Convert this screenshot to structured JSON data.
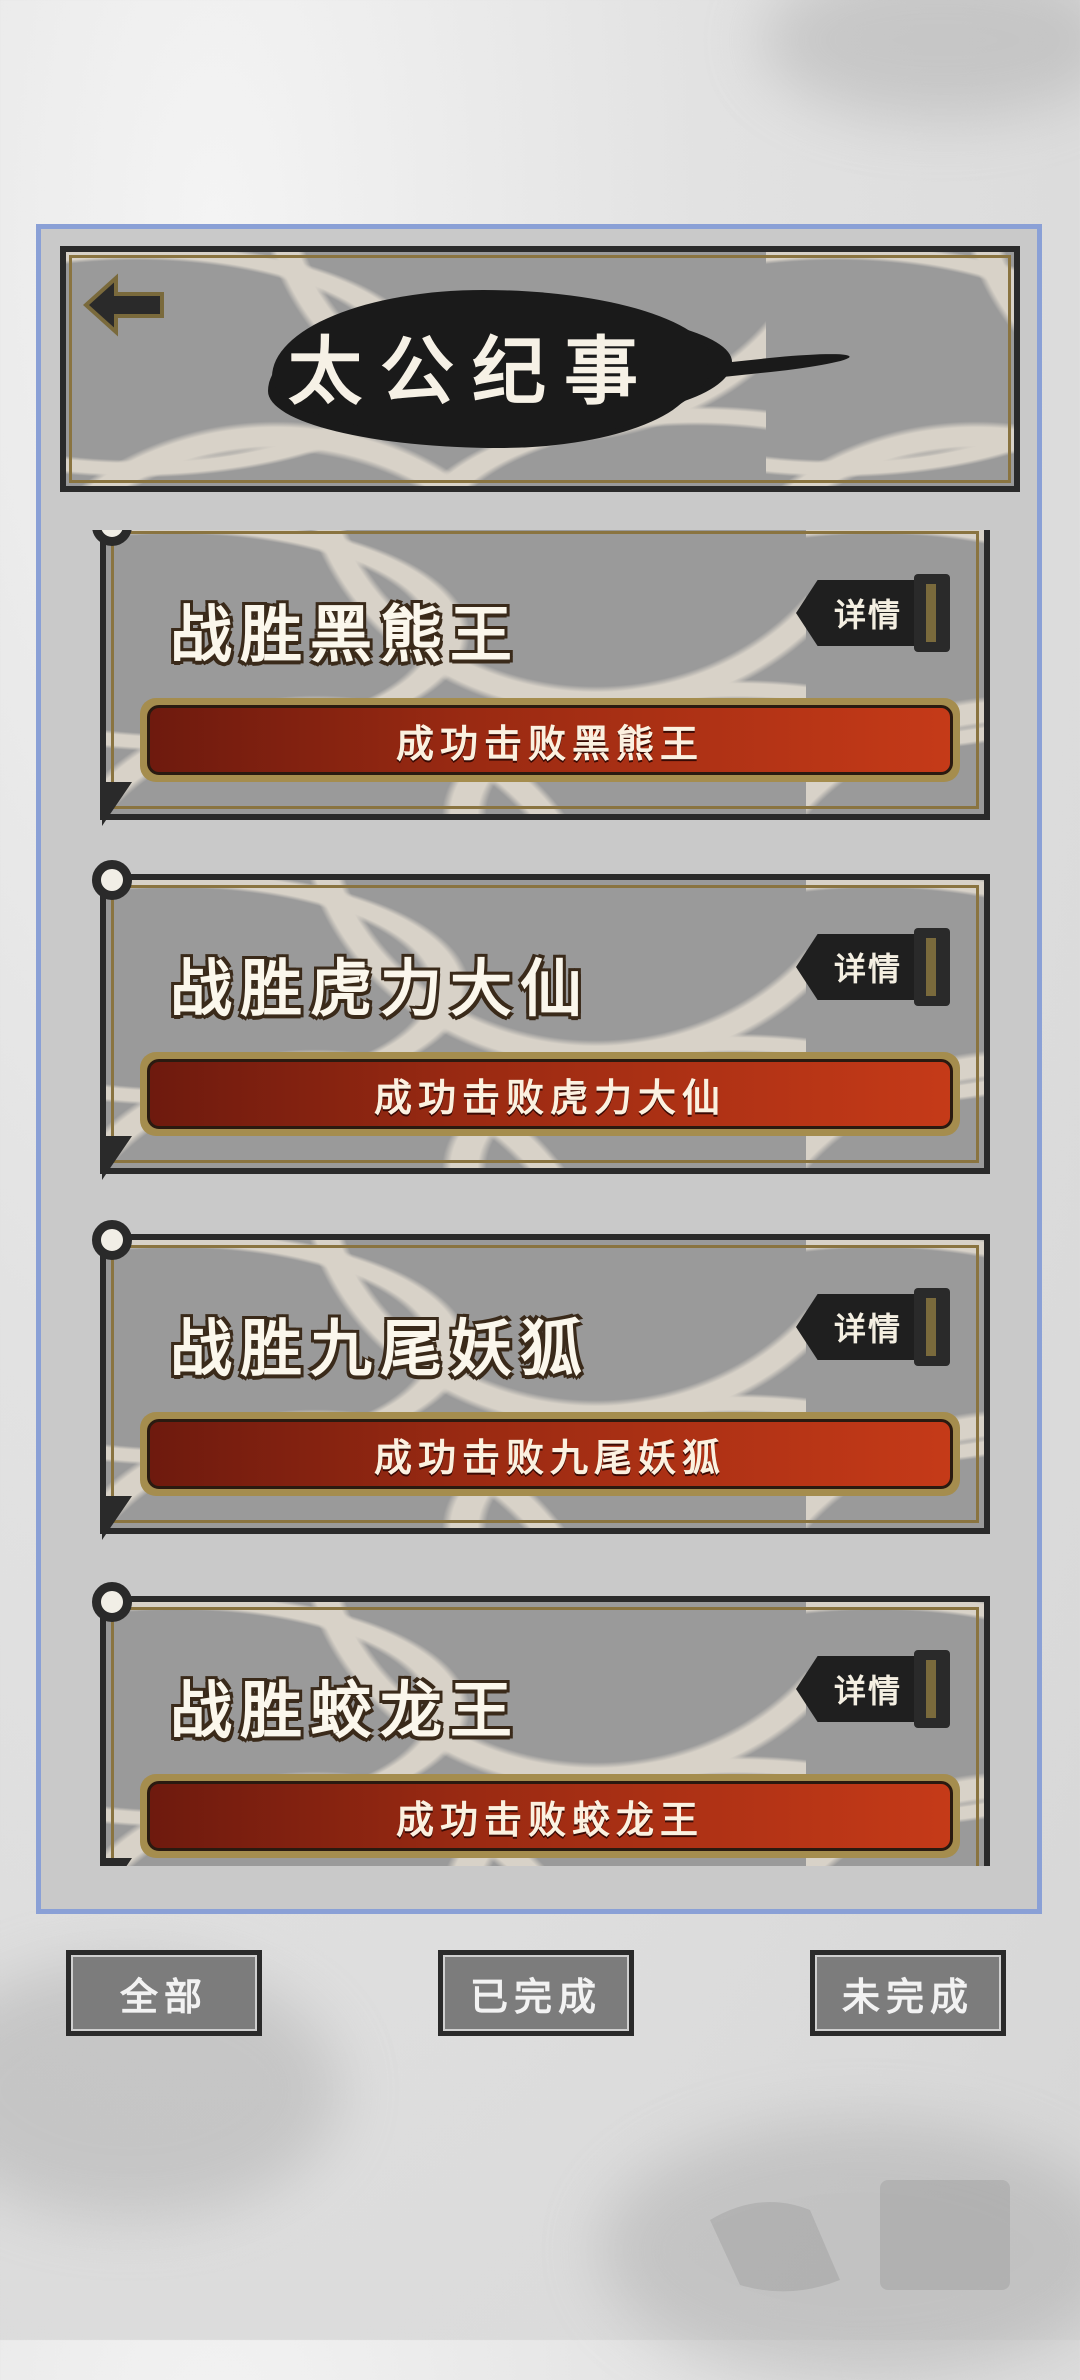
{
  "header": {
    "title": "太公纪事"
  },
  "achievements": [
    {
      "title": "战胜黑熊王",
      "detail_label": "详情",
      "description": "成功击败黑熊王"
    },
    {
      "title": "战胜虎力大仙",
      "detail_label": "详情",
      "description": "成功击败虎力大仙"
    },
    {
      "title": "战胜九尾妖狐",
      "detail_label": "详情",
      "description": "成功击败九尾妖狐"
    },
    {
      "title": "战胜蛟龙王",
      "detail_label": "详情",
      "description": "成功击败蛟龙王"
    }
  ],
  "filters": [
    {
      "label": "全部"
    },
    {
      "label": "已完成"
    },
    {
      "label": "未完成"
    }
  ],
  "colors": {
    "banner_red": "#c53a18",
    "frame_blue": "#8aa0d6",
    "trim_gold": "#8a7440"
  }
}
